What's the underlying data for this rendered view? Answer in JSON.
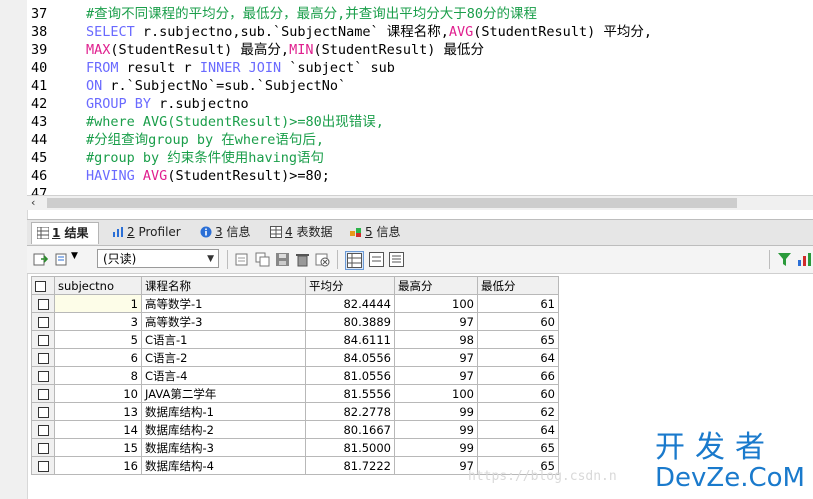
{
  "editor": {
    "lines": [
      {
        "no": "37",
        "segments": [
          [
            "cm",
            "#查询不同课程的平均分，最低分，最高分,并查询出平均分大于80分的课程"
          ]
        ]
      },
      {
        "no": "38",
        "segments": [
          [
            "kw",
            "SELECT"
          ],
          [
            "",
            "r.subjectno,sub.`SubjectName` 课程名称,"
          ],
          [
            "fn",
            "AVG"
          ],
          [
            "",
            "(StudentResult) 平均分,"
          ]
        ]
      },
      {
        "no": "39",
        "segments": [
          [
            "fn",
            "MAX"
          ],
          [
            "",
            "(StudentResult) 最高分,"
          ],
          [
            "fn",
            "MIN"
          ],
          [
            "",
            "(StudentResult) 最低分"
          ]
        ]
      },
      {
        "no": "40",
        "segments": [
          [
            "kw",
            "FROM"
          ],
          [
            "",
            "result r "
          ],
          [
            "kw",
            "INNER JOIN"
          ],
          [
            "",
            "`subject` sub"
          ]
        ]
      },
      {
        "no": "41",
        "segments": [
          [
            "kw",
            "ON"
          ],
          [
            "",
            "r.`SubjectNo`=sub.`SubjectNo`"
          ]
        ]
      },
      {
        "no": "42",
        "segments": [
          [
            "kw",
            "GROUP BY"
          ],
          [
            "",
            "r.subjectno"
          ]
        ]
      },
      {
        "no": "43",
        "segments": [
          [
            "cm",
            "#where AVG(StudentResult)>=80出现错误,"
          ]
        ]
      },
      {
        "no": "44",
        "segments": [
          [
            "cm",
            "#分组查询group by 在where语句后,"
          ]
        ]
      },
      {
        "no": "45",
        "segments": [
          [
            "cm",
            "#group by 约束条件使用having语句"
          ]
        ]
      },
      {
        "no": "46",
        "segments": [
          [
            "kw",
            "HAVING"
          ],
          [
            "fn",
            "AVG"
          ],
          [
            "",
            "(StudentResult)>=80;"
          ]
        ]
      },
      {
        "no": "47",
        "segments": []
      }
    ]
  },
  "tabs": [
    {
      "num": "1",
      "label": "结果",
      "active": true
    },
    {
      "num": "2",
      "label": "Profiler",
      "active": false
    },
    {
      "num": "3",
      "label": "信息",
      "active": false
    },
    {
      "num": "4",
      "label": "表数据",
      "active": false
    },
    {
      "num": "5",
      "label": "信息",
      "active": false
    }
  ],
  "toolbar": {
    "mode_select": "(只读)"
  },
  "grid": {
    "headers": [
      "subjectno",
      "课程名称",
      "平均分",
      "最高分",
      "最低分"
    ],
    "rows": [
      [
        "1",
        "高等数学-1",
        "82.4444",
        "100",
        "61"
      ],
      [
        "3",
        "高等数学-3",
        "80.3889",
        "97",
        "60"
      ],
      [
        "5",
        "C语言-1",
        "84.6111",
        "98",
        "65"
      ],
      [
        "6",
        "C语言-2",
        "84.0556",
        "97",
        "64"
      ],
      [
        "8",
        "C语言-4",
        "81.0556",
        "97",
        "66"
      ],
      [
        "10",
        "JAVA第二学年",
        "81.5556",
        "100",
        "60"
      ],
      [
        "13",
        "数据库结构-1",
        "82.2778",
        "99",
        "62"
      ],
      [
        "14",
        "数据库结构-2",
        "80.1667",
        "99",
        "64"
      ],
      [
        "15",
        "数据库结构-3",
        "81.5000",
        "99",
        "65"
      ],
      [
        "16",
        "数据库结构-4",
        "81.7222",
        "97",
        "65"
      ]
    ]
  },
  "watermark": "https://blog.csdn.n",
  "brand": {
    "line1": "开发者",
    "line2": "DevZe.CoM"
  },
  "colors": {
    "keyword": "#6a6aff",
    "function": "#e0208f",
    "comment": "#1a9e4a",
    "brand": "#1a7acc"
  }
}
